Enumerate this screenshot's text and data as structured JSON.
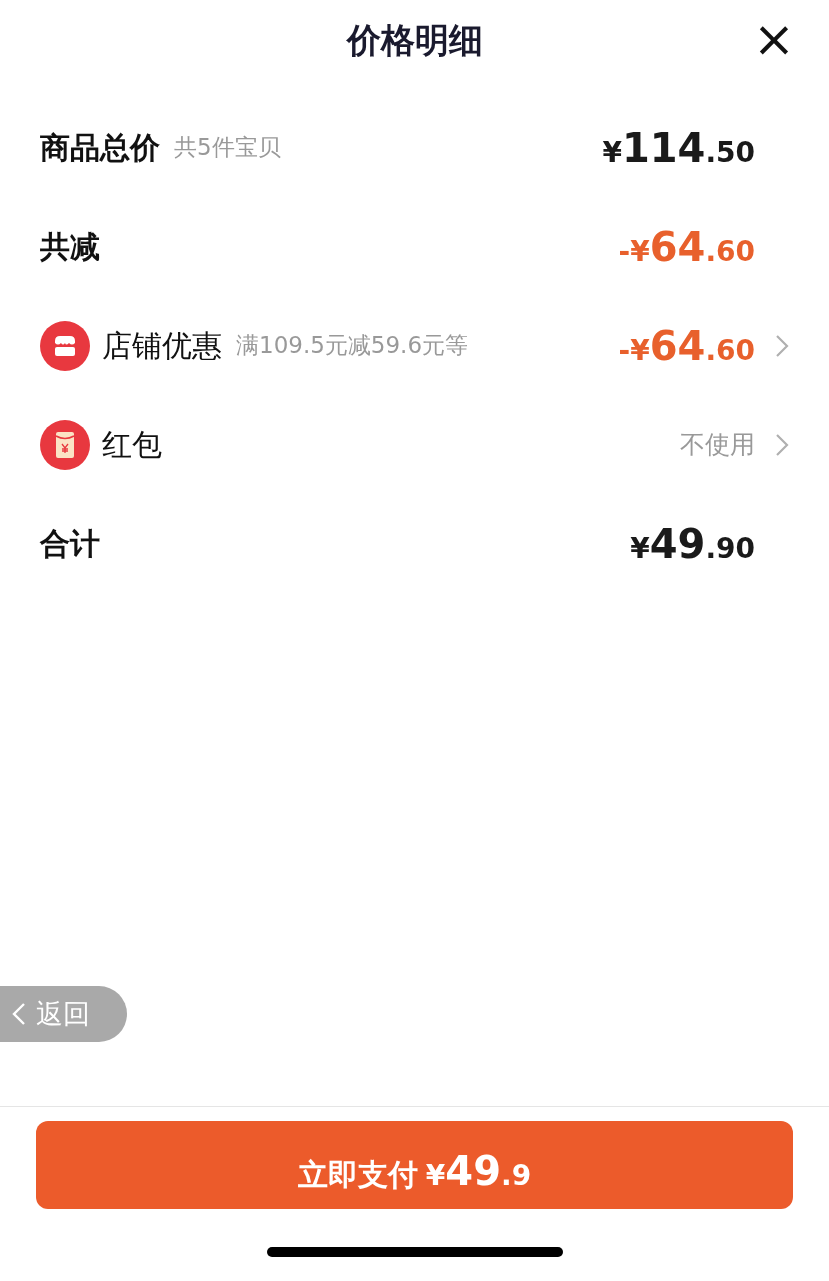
{
  "title": "价格明细",
  "close": "×",
  "rows": [
    {
      "kind": "plain",
      "label": "商品总价",
      "note": "共5件宝贝",
      "amount": {
        "currency": "¥",
        "integer": "114",
        "decimal": ".50"
      },
      "discount": false
    },
    {
      "kind": "plain",
      "label": "共减",
      "amount": {
        "currency": "-¥",
        "integer": "64",
        "decimal": ".60"
      },
      "discount": true
    },
    {
      "kind": "store",
      "label": "店铺优惠",
      "note": "满109.5元减59.6元等",
      "amount": {
        "currency": "-¥",
        "integer": "64",
        "decimal": ".60"
      },
      "discount": true
    },
    {
      "kind": "packet",
      "label": "红包",
      "value": "不使用"
    },
    {
      "kind": "plain",
      "label": "合计",
      "amount": {
        "currency": "¥",
        "integer": "49",
        "decimal": ".90"
      },
      "discount": false
    }
  ],
  "back": "返回",
  "pay": {
    "label": "立即支付",
    "currency": "¥",
    "integer": "49",
    "decimal": ".9"
  }
}
